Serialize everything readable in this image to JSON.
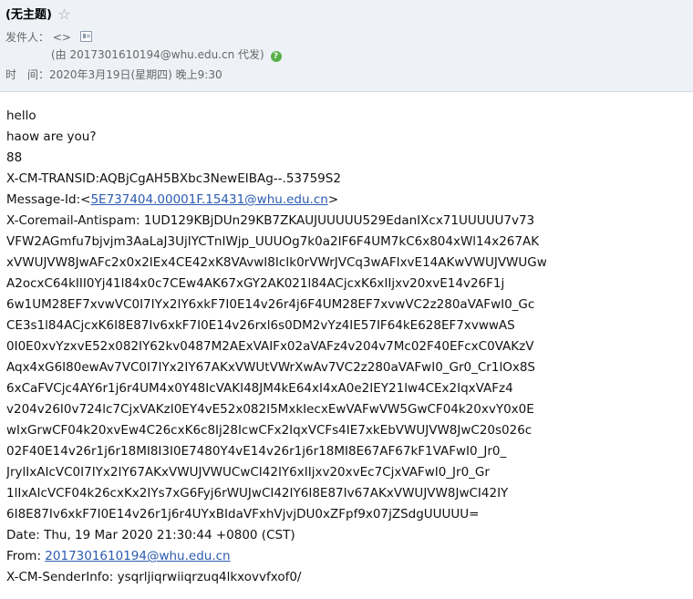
{
  "header": {
    "subject": "(无主题)",
    "star_icon": "star-outline-icon",
    "sender_label": "发件人：",
    "sender_value": "<>",
    "via_prefix": "(由 ",
    "via_address": "2017301610194@whu.edu.cn",
    "via_suffix": " 代发)",
    "time_label": "时　间：",
    "time_value": "2020年3月19日(星期四) 晚上9:30"
  },
  "body": {
    "lines": [
      "hello",
      "haow are you?",
      "88",
      "X-CM-TRANSID:AQBjCgAH5BXbc3NewEIBAg--.53759S2"
    ],
    "message_id_prefix": "Message-Id:<",
    "message_id_link": "5E737404.00001F.15431@whu.edu.cn",
    "message_id_suffix": ">",
    "antispam": [
      "X-Coremail-Antispam: 1UD129KBjDUn29KB7ZKAUJUUUUU529EdanIXcx71UUUUU7v73",
      "VFW2AGmfu7bjvjm3AaLaJ3UjIYCTnIWjp_UUUOg7k0a2IF6F4UM7kC6x804xWl14x267AK",
      "xVWUJVW8JwAFc2x0x2IEx4CE42xK8VAvwI8IcIk0rVWrJVCq3wAFIxvE14AKwVWUJVWUGw",
      "A2ocxC64kIII0Yj41l84x0c7CEw4AK67xGY2AK021l84ACjcxK6xIIjxv20xvE14v26F1j",
      "6w1UM28EF7xvwVC0I7IYx2IY6xkF7I0E14v26r4j6F4UM28EF7xvwVC2z280aVAFwI0_Gc",
      "CE3s1l84ACjcxK6I8E87Iv6xkF7I0E14v26rxl6s0DM2vYz4IE57IF64kE628EF7xvwwAS",
      "0I0E0xvYzxvE52x082IY62kv0487M2AExVAIFx02aVAFz4v204v7Mc02F40EFcxC0VAKzV",
      "Aqx4xG6I80ewAv7VC0I7IYx2IY67AKxVWUtVWrXwAv7VC2z280aVAFwI0_Gr0_Cr1lOx8S",
      "6xCaFVCjc4AY6r1j6r4UM4x0Y48IcVAKI48JM4kE64xI4xA0e2IEY21lw4CEx2IqxVAFz4",
      "v204v26I0v724lc7CjxVAKzI0EY4vE52x082I5MxkIecxEwVAFwVW5GwCF04k20xvY0x0E",
      "wIxGrwCF04k20xvEw4C26cxK6c8Ij28IcwCFx2IqxVCFs4IE7xkEbVWUJVW8JwC20s026c",
      "02F40E14v26r1j6r18MI8I3I0E7480Y4vE14v26r1j6r18MI8E67AF67kF1VAFwI0_Jr0_",
      "JrylIxAIcVC0I7IYx2IY67AKxVWUJVWUCwCI42IY6xIIjxv20xvEc7CjxVAFwI0_Jr0_Gr",
      "1lIxAIcVCF04k26cxKx2IYs7xG6Fyj6rWUJwCI42IY6I8E87Iv67AKxVWUJVW8JwCI42IY",
      "6I8E87Iv6xkF7I0E14v26r1j6r4UYxBIdaVFxhVjvjDU0xZFpf9x07jZSdgUUUUU="
    ],
    "date_line": "Date: Thu, 19 Mar 2020 21:30:44 +0800 (CST)",
    "from_prefix": "From: ",
    "from_link": "2017301610194@whu.edu.cn",
    "senderinfo_line": "X-CM-SenderInfo: ysqrljiqrwiiqrzuq4lkxovvfxof0/"
  },
  "colors": {
    "header_bg": "#eef2f7",
    "link": "#2b5bb0",
    "help_icon": "#58b04a"
  }
}
